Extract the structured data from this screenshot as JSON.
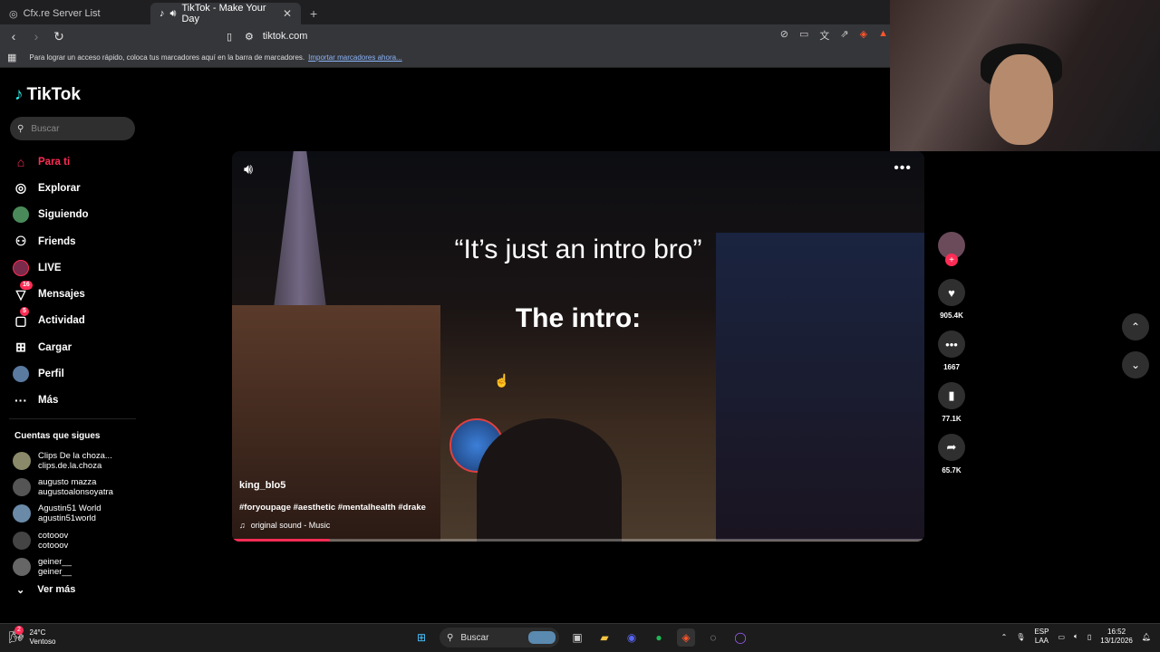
{
  "browser": {
    "tabs": [
      {
        "title": "Cfx.re Server List",
        "active": false
      },
      {
        "title": "TikTok - Make Your Day",
        "active": true
      }
    ],
    "address": "tiktok.com",
    "bookmarks_hint": "Para lograr un acceso rápido, coloca tus marcadores aquí en la barra de marcadores.",
    "bookmarks_link": "Importar marcadores ahora..."
  },
  "sidebar": {
    "logo": "TikTok",
    "search_placeholder": "Buscar",
    "nav": [
      {
        "label": "Para ti",
        "icon": "home-icon",
        "active": true
      },
      {
        "label": "Explorar",
        "icon": "compass-icon"
      },
      {
        "label": "Siguiendo",
        "icon": "following-icon"
      },
      {
        "label": "Friends",
        "icon": "friends-icon"
      },
      {
        "label": "LIVE",
        "icon": "live-icon"
      },
      {
        "label": "Mensajes",
        "icon": "messages-icon",
        "badge": "16"
      },
      {
        "label": "Actividad",
        "icon": "activity-icon",
        "badge": "5"
      },
      {
        "label": "Cargar",
        "icon": "upload-icon"
      },
      {
        "label": "Perfil",
        "icon": "profile-icon"
      },
      {
        "label": "Más",
        "icon": "more-icon"
      }
    ],
    "following_title": "Cuentas que sigues",
    "following": [
      {
        "name": "Clips De la choza...",
        "handle": "clips.de.la.choza"
      },
      {
        "name": "augusto mazza",
        "handle": "augustoalonsoyatra"
      },
      {
        "name": "Agustin51 World",
        "handle": "agustin51world"
      },
      {
        "name": "cotooov",
        "handle": "cotooov"
      },
      {
        "name": "geiner__",
        "handle": "geiner__"
      }
    ],
    "see_more": "Ver más"
  },
  "video": {
    "caption_top": "“It’s just an intro bro”",
    "caption_bottom": "The intro:",
    "username": "king_blo5",
    "hashtags": "#foryoupage #aesthetic #mentalhealth #drake",
    "sound": "original sound - Music",
    "progress": 0.14
  },
  "actions": {
    "likes": "905.4K",
    "comments": "1667",
    "saves": "77.1K",
    "shares": "65.7K"
  },
  "taskbar": {
    "temp": "24°C",
    "weather": "Ventoso",
    "weather_badge": "2",
    "search": "Buscar",
    "lang1": "ESP",
    "lang2": "LAA",
    "time": "16:52",
    "date": "13/1/2026"
  },
  "colors": {
    "accent": "#fe2c55"
  }
}
